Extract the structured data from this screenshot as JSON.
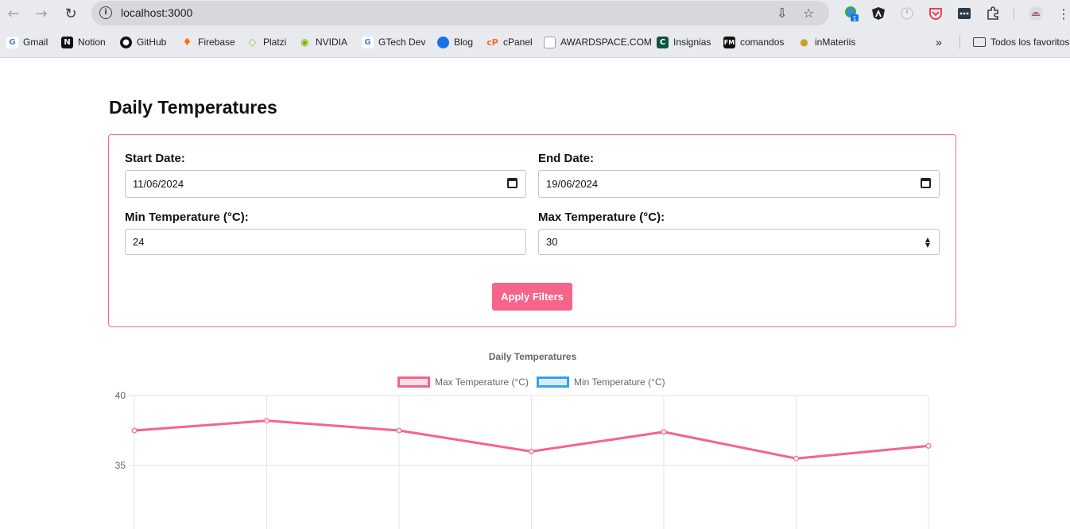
{
  "browser": {
    "url": "localhost:3000",
    "bookmarks": [
      {
        "label": "Gmail",
        "icon": "google-icon",
        "color": "#4285f4"
      },
      {
        "label": "Notion",
        "icon": "notion-icon",
        "color": "#111111"
      },
      {
        "label": "GitHub",
        "icon": "github-icon",
        "color": "#111111"
      },
      {
        "label": "Firebase",
        "icon": "firebase-icon",
        "color": "#ff9100"
      },
      {
        "label": "Platzi",
        "icon": "platzi-icon",
        "color": "#98ca3f"
      },
      {
        "label": "NVIDIA",
        "icon": "nvidia-icon",
        "color": "#76b900"
      },
      {
        "label": "GTech Dev",
        "icon": "google-icon",
        "color": "#4285f4"
      },
      {
        "label": "Blog",
        "icon": "blog-icon",
        "color": "#1a73e8"
      },
      {
        "label": "cPanel",
        "icon": "cpanel-icon",
        "color": "#ff6c2c"
      },
      {
        "label": "AWARDSPACE.COM",
        "icon": "awardspace-icon",
        "color": "#9aa0a6"
      },
      {
        "label": "Insignias",
        "icon": "insignias-icon",
        "color": "#0b5345"
      },
      {
        "label": "comandos",
        "icon": "fm-icon",
        "color": "#111111"
      },
      {
        "label": "inMateriis",
        "icon": "inmateriis-icon",
        "color": "#c9a227"
      }
    ],
    "all_bookmarks_label": "Todos los favoritos",
    "extension_badge": "1"
  },
  "page": {
    "title": "Daily Temperatures",
    "filters": {
      "start_date_label": "Start Date:",
      "start_date_value": "11/06/2024",
      "end_date_label": "End Date:",
      "end_date_value": "19/06/2024",
      "min_temp_label": "Min Temperature (°C):",
      "min_temp_value": "24",
      "max_temp_label": "Max Temperature (°C):",
      "max_temp_value": "30",
      "apply_label": "Apply Filters"
    }
  },
  "colors": {
    "accent": "#f5648a",
    "max_series": "#f5648a",
    "min_series": "#36a2eb"
  },
  "chart_data": {
    "type": "line",
    "title": "Daily Temperatures",
    "series": [
      {
        "name": "Max Temperature (°C)",
        "values": [
          37.5,
          38.2,
          37.5,
          36.0,
          37.4,
          35.5,
          36.4
        ]
      },
      {
        "name": "Min Temperature (°C)",
        "values": []
      }
    ],
    "y_ticks": [
      "40",
      "35"
    ],
    "ylim_visible": [
      30.2,
      40
    ],
    "grid": true,
    "legend_position": "top"
  }
}
